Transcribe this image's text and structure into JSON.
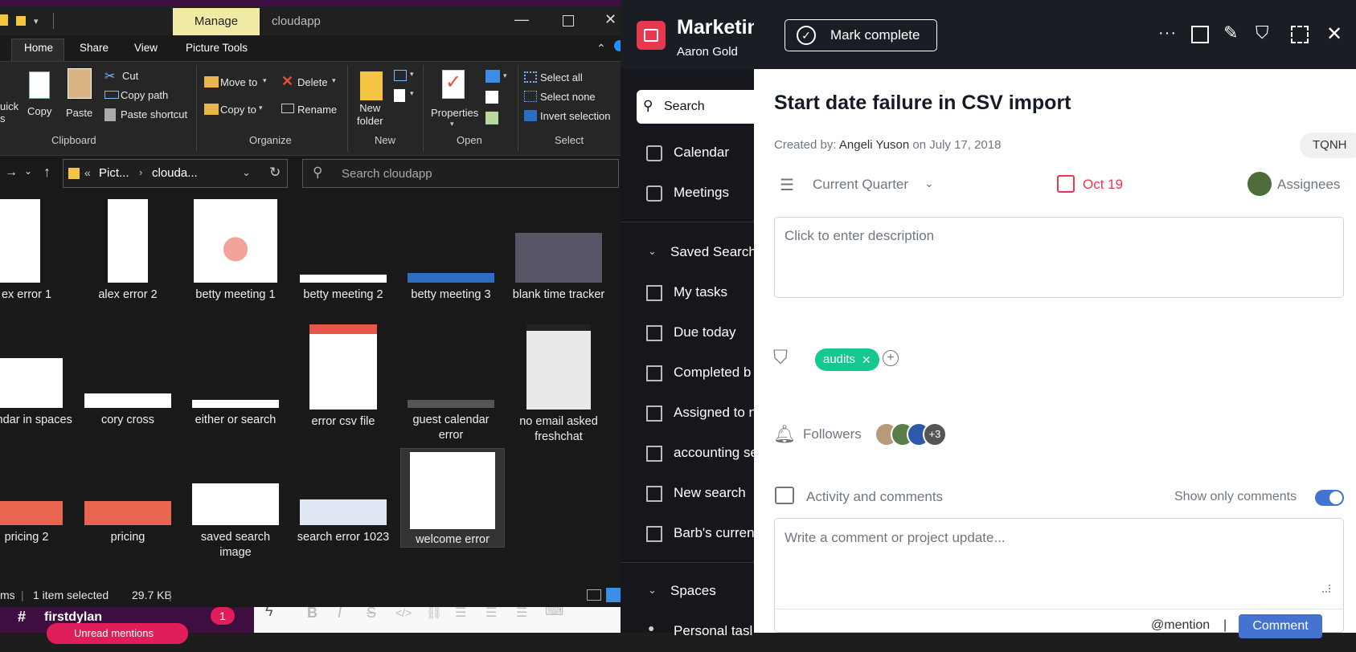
{
  "slack": {
    "channel": "firstdylan",
    "badge": "1",
    "unread_button": "Unread mentions"
  },
  "explorer": {
    "manage_tab": "Manage",
    "window_title": "cloudapp",
    "ribbon_tabs": [
      "Home",
      "Share",
      "View",
      "Picture Tools"
    ],
    "clipboard": {
      "quick": "uick\ns",
      "copy": "Copy",
      "paste": "Paste",
      "cut": "Cut",
      "copy_path": "Copy path",
      "paste_shortcut": "Paste shortcut",
      "group": "Clipboard"
    },
    "organize": {
      "move_to": "Move to",
      "copy_to": "Copy to",
      "delete": "Delete",
      "rename": "Rename",
      "group": "Organize"
    },
    "new": {
      "new_folder": "New\nfolder",
      "group": "New"
    },
    "open": {
      "properties": "Properties",
      "group": "Open"
    },
    "select": {
      "select_all": "Select all",
      "select_none": "Select none",
      "invert": "Invert selection",
      "group": "Select"
    },
    "address": {
      "part1": "Pict...",
      "part2": "clouda...",
      "more": "«"
    },
    "search_placeholder": "Search cloudapp",
    "files": [
      {
        "name": "ex error 1"
      },
      {
        "name": "alex error 2"
      },
      {
        "name": "betty meeting 1"
      },
      {
        "name": "betty meeting 2"
      },
      {
        "name": "betty meeting 3"
      },
      {
        "name": "blank time tracker"
      },
      {
        "name": "alendar in spaces"
      },
      {
        "name": "cory cross"
      },
      {
        "name": "either or search"
      },
      {
        "name": "error csv file"
      },
      {
        "name": "guest calendar error"
      },
      {
        "name": "no email asked freshchat"
      },
      {
        "name": "pricing 2"
      },
      {
        "name": "pricing"
      },
      {
        "name": "saved search image"
      },
      {
        "name": "search error 1023"
      },
      {
        "name": "welcome error"
      }
    ],
    "status": {
      "items": "ms",
      "selected": "1 item selected",
      "size": "29.7 KB"
    }
  },
  "app": {
    "project": "Marketin",
    "owner": "Aaron Gold",
    "search": "Search",
    "nav": [
      {
        "label": "Calendar",
        "icon": "calendar-icon"
      },
      {
        "label": "Meetings",
        "icon": "calendar-check-icon"
      }
    ],
    "saved_searches": "Saved Searche",
    "saved": [
      {
        "label": "My tasks"
      },
      {
        "label": "Due today"
      },
      {
        "label": "Completed b"
      },
      {
        "label": "Assigned to n"
      },
      {
        "label": "accounting se"
      },
      {
        "label": "New search"
      },
      {
        "label": "Barb's curren"
      }
    ],
    "spaces": "Spaces",
    "personal": "Personal tasl"
  },
  "task": {
    "mark_complete": "Mark complete",
    "title": "Start date failure in CSV import",
    "created_label": "Created by:",
    "created_name": "Angeli Yuson",
    "created_on": "on July 17, 2018",
    "tag_code": "TQNH",
    "section": "Current Quarter",
    "due": "Oct 19",
    "assignees": "Assignees",
    "description_placeholder": "Click to enter description",
    "tag": "audits",
    "followers": "Followers",
    "followers_more": "+3",
    "activity": "Activity and comments",
    "show_only_comments": "Show only comments",
    "comment_placeholder": "Write a comment or project update...",
    "mention": "@mention",
    "divider": "|",
    "comment_button": "Comment",
    "colors": {
      "due": "#e8384f",
      "tag": "#14c88f",
      "toggle": "#4573d2"
    }
  }
}
